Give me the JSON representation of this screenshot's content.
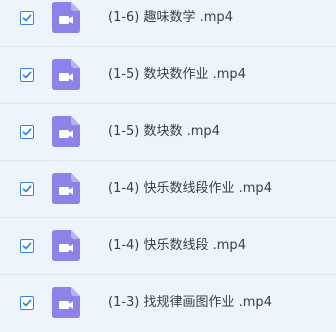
{
  "files": [
    {
      "name": "(1-6) 趣味数学 .mp4",
      "checked": true,
      "icon": "video-file-icon"
    },
    {
      "name": "(1-5) 数块数作业 .mp4",
      "checked": true,
      "icon": "video-file-icon"
    },
    {
      "name": "(1-5) 数块数 .mp4",
      "checked": true,
      "icon": "video-file-icon"
    },
    {
      "name": "(1-4) 快乐数线段作业 .mp4",
      "checked": true,
      "icon": "video-file-icon"
    },
    {
      "name": "(1-4) 快乐数线段 .mp4",
      "checked": true,
      "icon": "video-file-icon"
    },
    {
      "name": "(1-3) 找规律画图作业 .mp4",
      "checked": true,
      "icon": "video-file-icon"
    }
  ],
  "colors": {
    "checkbox": "#2f86e8",
    "icon": "#8b83e8",
    "background": "#eef4fb",
    "text": "#3b3f45"
  }
}
